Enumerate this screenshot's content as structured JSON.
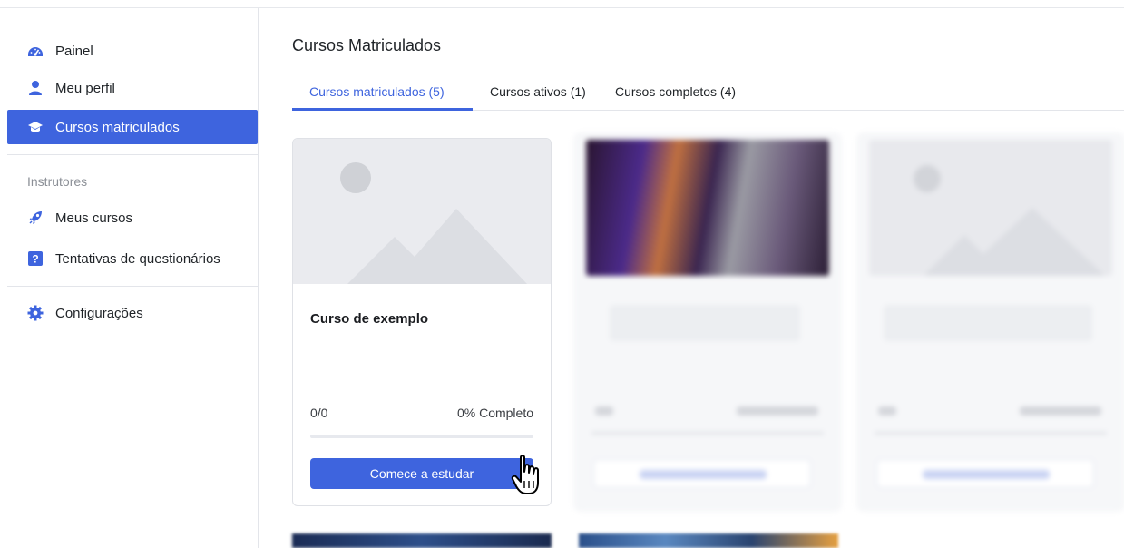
{
  "sidebar": {
    "items": [
      {
        "label": "Painel",
        "icon": "dashboard-icon"
      },
      {
        "label": "Meu perfil",
        "icon": "user-icon"
      },
      {
        "label": "Cursos matriculados",
        "icon": "graduation-cap-icon",
        "active": true
      }
    ],
    "section_label": "Instrutores",
    "instructor_items": [
      {
        "label": "Meus cursos",
        "icon": "rocket-icon"
      },
      {
        "label": "Tentativas de questionários",
        "icon": "question-icon"
      }
    ],
    "settings": {
      "label": "Configurações",
      "icon": "gear-icon"
    }
  },
  "main": {
    "title": "Cursos Matriculados",
    "tabs": [
      {
        "label": "Cursos matriculados (5)",
        "active": true
      },
      {
        "label": "Cursos ativos (1)"
      },
      {
        "label": "Cursos completos (4)"
      }
    ],
    "course_card": {
      "title": "Curso de exemplo",
      "progress_count": "0/0",
      "progress_percent_label": "0% Completo",
      "progress": 0,
      "button_label": "Comece a estudar"
    }
  },
  "colors": {
    "accent": "#3e64de",
    "text": "#1f2327",
    "muted": "#8c9097",
    "border": "#e3e5ea"
  }
}
